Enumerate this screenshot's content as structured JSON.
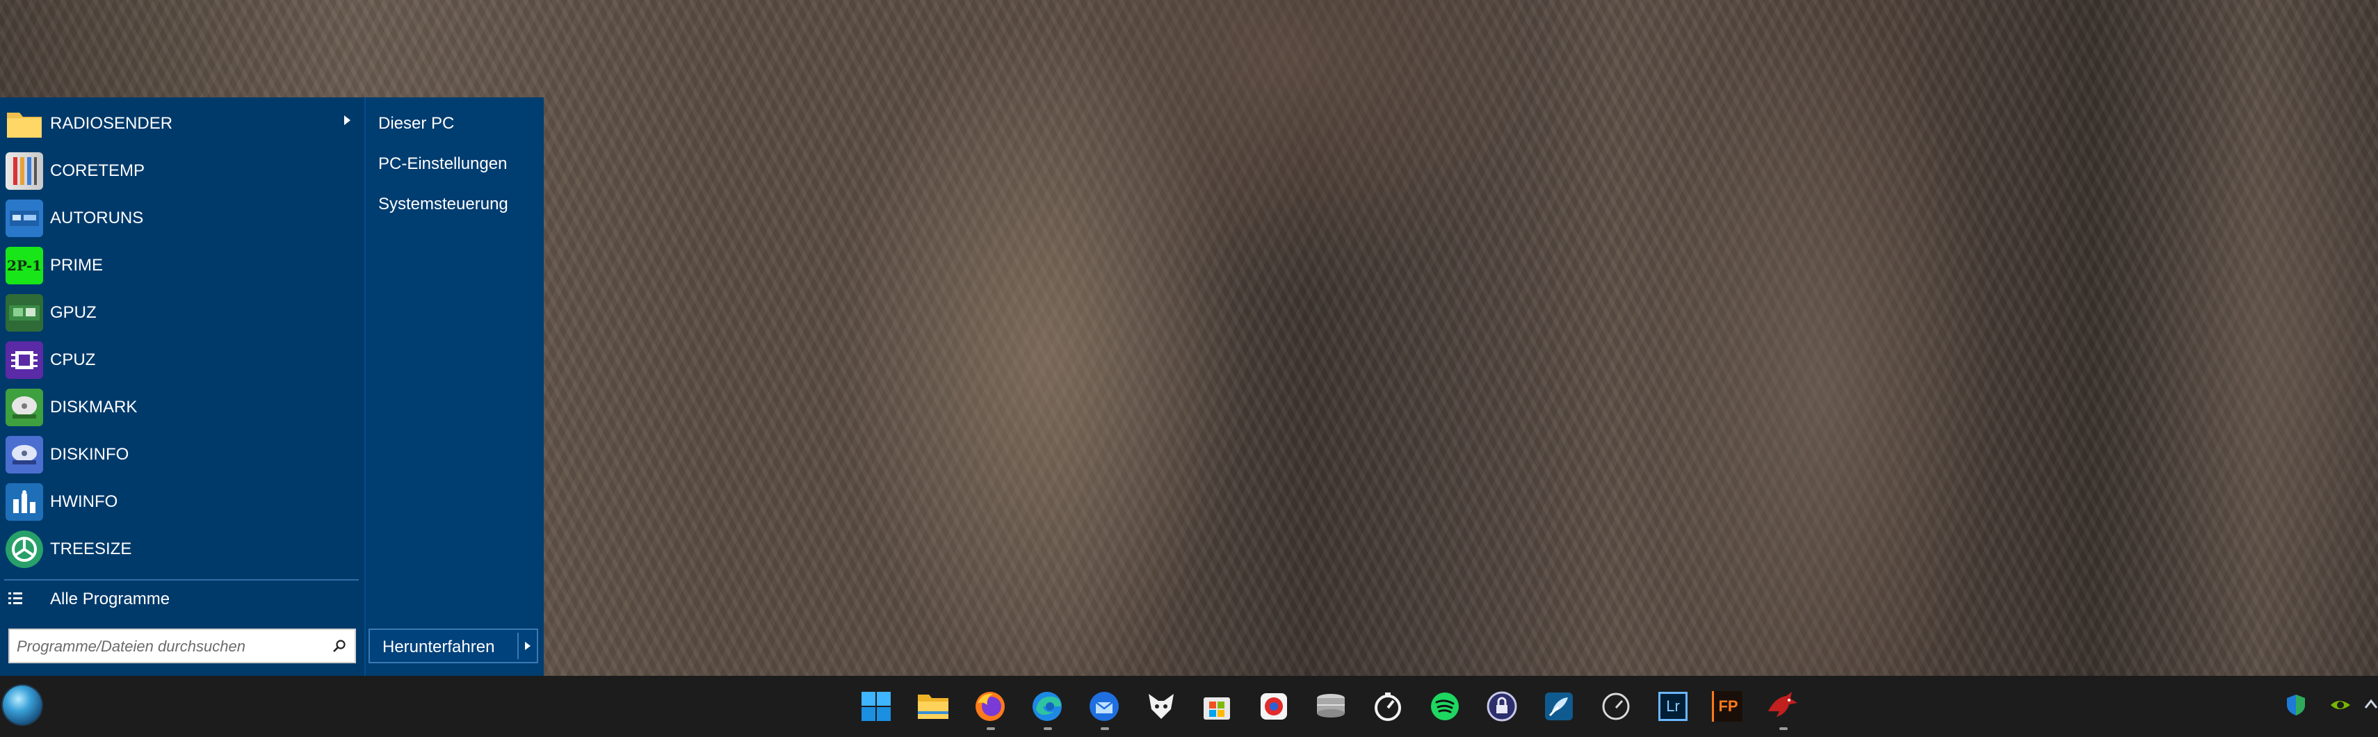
{
  "start_menu": {
    "programs": [
      {
        "label": "RADIOSENDER",
        "icon": "folder-icon",
        "has_submenu": true
      },
      {
        "label": "CORETEMP",
        "icon": "coretemp-icon"
      },
      {
        "label": "AUTORUNS",
        "icon": "autoruns-icon"
      },
      {
        "label": "PRIME",
        "icon": "prime-icon"
      },
      {
        "label": "GPUZ",
        "icon": "gpuz-icon"
      },
      {
        "label": "CPUZ",
        "icon": "cpuz-icon"
      },
      {
        "label": "DISKMARK",
        "icon": "diskmark-icon"
      },
      {
        "label": "DISKINFO",
        "icon": "diskinfo-icon"
      },
      {
        "label": "HWINFO",
        "icon": "hwinfo-icon"
      },
      {
        "label": "TREESIZE",
        "icon": "treesize-icon"
      }
    ],
    "all_programs_label": "Alle Programme",
    "search_placeholder": "Programme/Dateien durchsuchen",
    "places": [
      "Dieser PC",
      "PC-Einstellungen",
      "Systemsteuerung"
    ],
    "shutdown_label": "Herunterfahren",
    "colors": {
      "background": "#003a6b",
      "accent": "#3a79b3"
    }
  },
  "taskbar": {
    "apps": [
      {
        "name": "windows-start-icon",
        "running": false
      },
      {
        "name": "file-explorer-icon",
        "running": false
      },
      {
        "name": "firefox-icon",
        "running": true
      },
      {
        "name": "edge-icon",
        "running": true
      },
      {
        "name": "thunderbird-icon",
        "running": true
      },
      {
        "name": "fox-app-icon",
        "running": false
      },
      {
        "name": "microsoft-store-icon",
        "running": false
      },
      {
        "name": "red-badge-app-icon",
        "running": false
      },
      {
        "name": "disk-stack-icon",
        "running": false
      },
      {
        "name": "gauge-timer-icon",
        "running": false
      },
      {
        "name": "spotify-icon",
        "running": false
      },
      {
        "name": "lock-app-icon",
        "running": false
      },
      {
        "name": "feather-app-icon",
        "running": false
      },
      {
        "name": "speedometer-icon",
        "running": false
      },
      {
        "name": "lightroom-icon",
        "label": "Lr",
        "running": false
      },
      {
        "name": "fastpictureviewer-icon",
        "label": "FP",
        "running": false
      },
      {
        "name": "dragon-app-icon",
        "running": true
      }
    ],
    "tray": [
      "windows-security-icon",
      "nvidia-icon"
    ]
  }
}
